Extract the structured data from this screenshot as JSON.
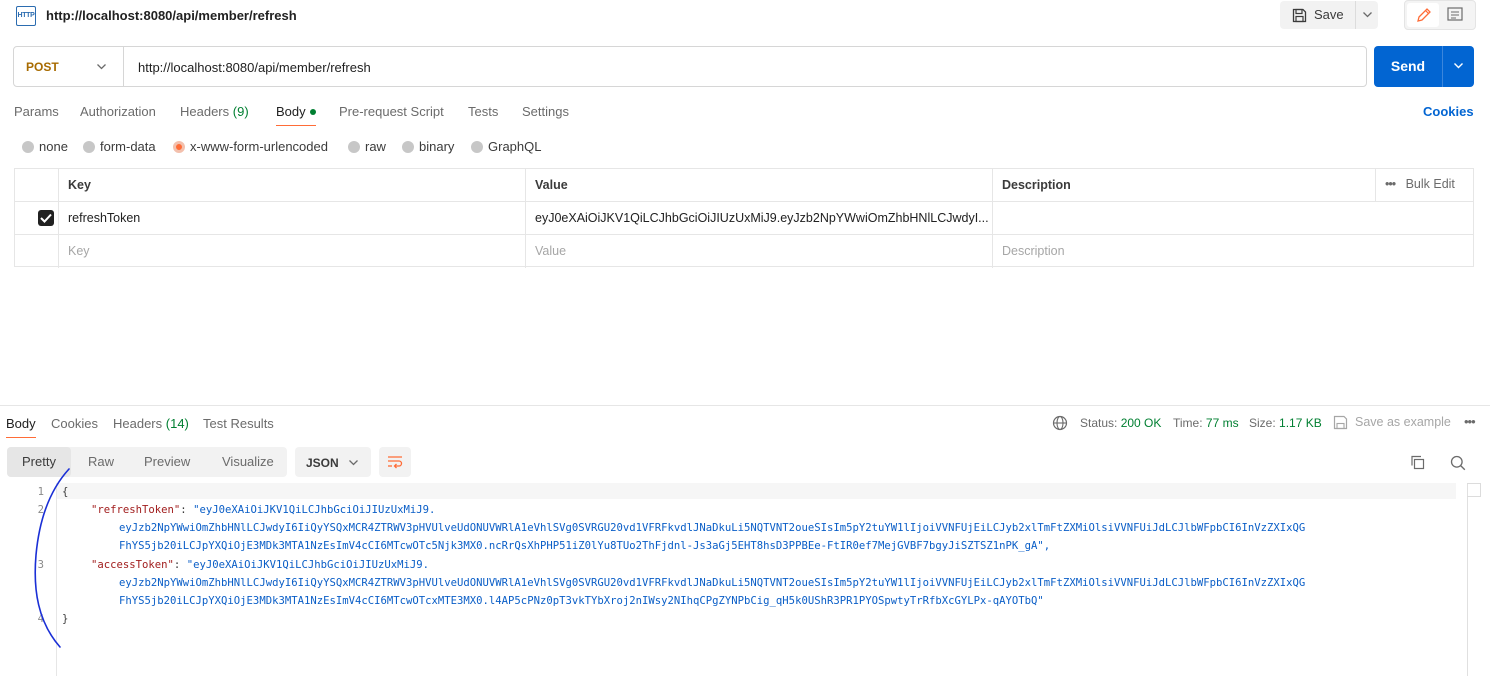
{
  "titlebar": {
    "icon_text": "HTTP",
    "title": "http://localhost:8080/api/member/refresh",
    "save_label": "Save"
  },
  "request": {
    "method": "POST",
    "url": "http://localhost:8080/api/member/refresh",
    "send_label": "Send"
  },
  "req_tabs": {
    "params": "Params",
    "authorization": "Authorization",
    "headers": "Headers",
    "headers_count": "(9)",
    "body": "Body",
    "prerequest": "Pre-request Script",
    "tests": "Tests",
    "settings": "Settings",
    "cookies": "Cookies"
  },
  "body_types": {
    "none": "none",
    "form_data": "form-data",
    "urlencoded": "x-www-form-urlencoded",
    "raw": "raw",
    "binary": "binary",
    "graphql": "GraphQL",
    "selected": "x-www-form-urlencoded"
  },
  "params_table": {
    "headers": {
      "key": "Key",
      "value": "Value",
      "description": "Description",
      "bulk_edit": "Bulk Edit",
      "more": "•••"
    },
    "rows": [
      {
        "checked": true,
        "key": "refreshToken",
        "value": "eyJ0eXAiOiJKV1QiLCJhbGciOiJIUzUxMiJ9.eyJzb2NpYWwiOmZhbHNlLCJwdyI...",
        "description": ""
      }
    ],
    "placeholder": {
      "key": "Key",
      "value": "Value",
      "description": "Description"
    }
  },
  "response": {
    "tabs": {
      "body": "Body",
      "cookies": "Cookies",
      "headers": "Headers",
      "headers_count": "(14)",
      "test_results": "Test Results"
    },
    "status_label": "Status:",
    "status_value": "200 OK",
    "time_label": "Time:",
    "time_value": "77 ms",
    "size_label": "Size:",
    "size_value": "1.17 KB",
    "save_example": "Save as example",
    "more": "•••",
    "format_tabs": {
      "pretty": "Pretty",
      "raw": "Raw",
      "preview": "Preview",
      "visualize": "Visualize"
    },
    "format": "JSON",
    "code": {
      "line_numbers": [
        "1",
        "2",
        "3",
        "4"
      ],
      "open_brace": "{",
      "close_brace": "}",
      "refresh_key": "\"refreshToken\"",
      "refresh_line1": "\"eyJ0eXAiOiJKV1QiLCJhbGciOiJIUzUxMiJ9.",
      "refresh_line2": "eyJzb2NpYWwiOmZhbHNlLCJwdyI6IiQyYSQxMCR4ZTRWV3pHVUlveUdONUVWRlA1eVhlSVg0SVRGU20vd1VFRFkvdlJNaDkuLi5NQTVNT2oueSIsIm5pY2tuYW1lIjoiVVNFUjEiLCJyb2xlTmFtZXMiOlsiVVNFUiJdLCJlbWFpbCI6InVzZXIxQG",
      "refresh_line3": "FhYS5jb20iLCJpYXQiOjE3MDk3MTA1NzEsImV4cCI6MTcwOTc5Njk3MX0.ncRrQsXhPHP51iZ0lYu8TUo2ThFjdnl-Js3aGj5EHT8hsD3PPBEe-FtIR0ef7MejGVBF7bgyJiSZTSZ1nPK_gA\",",
      "access_key": "\"accessToken\"",
      "access_line1": "\"eyJ0eXAiOiJKV1QiLCJhbGciOiJIUzUxMiJ9.",
      "access_line2": "eyJzb2NpYWwiOmZhbHNlLCJwdyI6IiQyYSQxMCR4ZTRWV3pHVUlveUdONUVWRlA1eVhlSVg0SVRGU20vd1VFRFkvdlJNaDkuLi5NQTVNT2oueSIsIm5pY2tuYW1lIjoiVVNFUjEiLCJyb2xlTmFtZXMiOlsiVVNFUiJdLCJlbWFpbCI6InVzZXIxQG",
      "access_line3": "FhYS5jb20iLCJpYXQiOjE3MDk3MTA1NzEsImV4cCI6MTcwOTcxMTE3MX0.l4AP5cPNz0pT3vkTYbXroj2nIWsy2NIhqCPgZYNPbCig_qH5k0UShR3PR1PYOSpwtyTrRfbXcGYLPx-qAYOTbQ\""
    }
  },
  "colors": {
    "accent_orange": "#ff6c37",
    "send_blue": "#0265d2",
    "method_post": "#a86b00",
    "status_green": "#007f31",
    "json_key": "#a11d1d",
    "json_string": "#0a5ec7",
    "pen_annotation": "#1a2fd6"
  }
}
